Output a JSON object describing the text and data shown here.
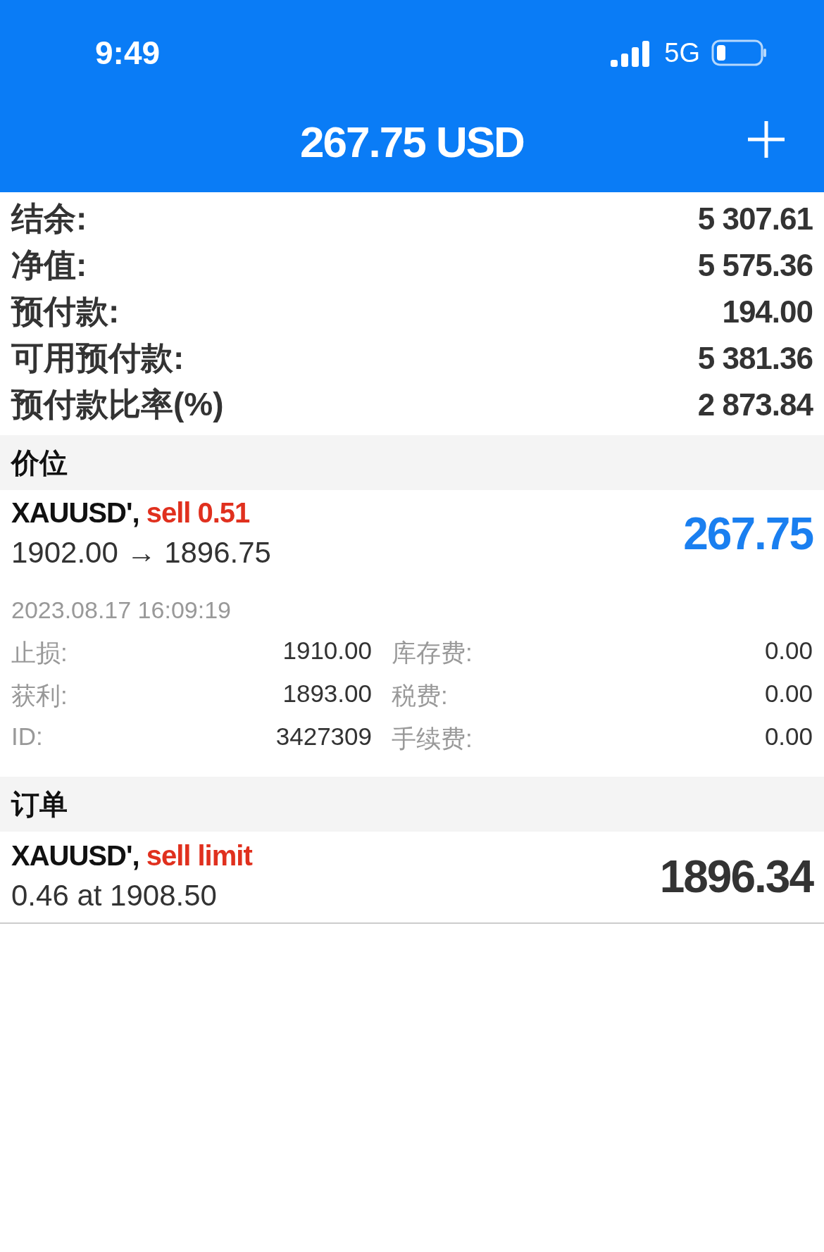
{
  "status_bar": {
    "time": "9:49",
    "network": "5G"
  },
  "header": {
    "title": "267.75 USD"
  },
  "account": [
    {
      "label": "结余:",
      "value": "5 307.61"
    },
    {
      "label": "净值:",
      "value": "5 575.36"
    },
    {
      "label": "预付款:",
      "value": "194.00"
    },
    {
      "label": "可用预付款:",
      "value": "5 381.36"
    },
    {
      "label": "预付款比率(%)",
      "value": "2 873.84"
    }
  ],
  "positions": {
    "title": "价位",
    "items": [
      {
        "symbol": "XAUUSD',",
        "side": "sell 0.51",
        "prices": "1902.00 → 1896.75",
        "profit": "267.75",
        "time": "2023.08.17 16:09:19",
        "details": [
          {
            "label": "止损:",
            "value": "1910.00",
            "label2": "库存费:",
            "value2": "0.00"
          },
          {
            "label": "获利:",
            "value": "1893.00",
            "label2": "税费:",
            "value2": "0.00"
          },
          {
            "label": "ID:",
            "value": "3427309",
            "label2": "手续费:",
            "value2": "0.00"
          }
        ]
      }
    ]
  },
  "orders": {
    "title": "订单",
    "items": [
      {
        "symbol": "XAUUSD',",
        "type": "sell limit",
        "detail": "0.46 at 1908.50",
        "price": "1896.34"
      }
    ]
  }
}
